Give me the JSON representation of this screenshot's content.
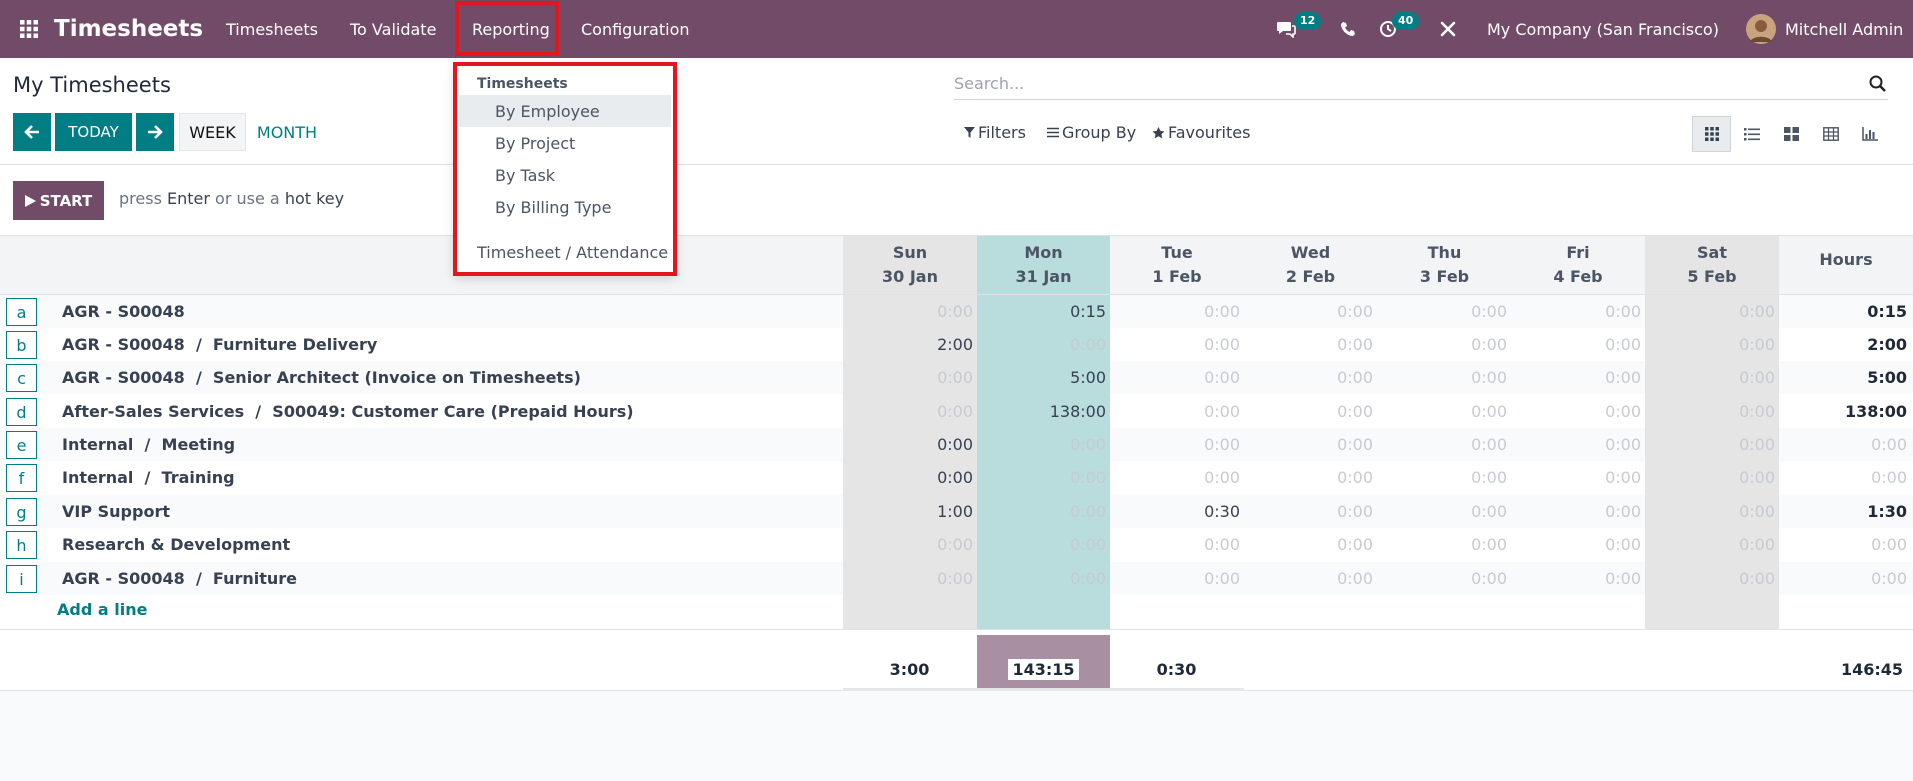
{
  "navbar": {
    "app_name": "Timesheets",
    "menus": [
      "Timesheets",
      "To Validate",
      "Reporting",
      "Configuration"
    ],
    "chat_badge": "12",
    "activity_badge": "40",
    "company": "My Company (San Francisco)",
    "user": "Mitchell Admin"
  },
  "control": {
    "title": "My Timesheets",
    "today": "TODAY",
    "week": "WEEK",
    "month": "MONTH",
    "search_placeholder": "Search...",
    "filters": "Filters",
    "group_by": "Group By",
    "favourites": "Favourites"
  },
  "start": {
    "label": "START",
    "hint_prefix": "press",
    "hint_key1": "Enter",
    "hint_mid": "or use a",
    "hint_key2": "hot key"
  },
  "reporting_menu": {
    "header": "Timesheets",
    "items": [
      "By Employee",
      "By Project",
      "By Task",
      "By Billing Type"
    ],
    "extra": "Timesheet / Attendance"
  },
  "grid": {
    "days": [
      {
        "day": "Sun",
        "date": "30 Jan"
      },
      {
        "day": "Mon",
        "date": "31 Jan"
      },
      {
        "day": "Tue",
        "date": "1 Feb"
      },
      {
        "day": "Wed",
        "date": "2 Feb"
      },
      {
        "day": "Thu",
        "date": "3 Feb"
      },
      {
        "day": "Fri",
        "date": "4 Feb"
      },
      {
        "day": "Sat",
        "date": "5 Feb"
      }
    ],
    "hours_header": "Hours",
    "rows": [
      {
        "key": "a",
        "label": "AGR - S00048",
        "values": [
          "0:00",
          "0:15",
          "0:00",
          "0:00",
          "0:00",
          "0:00",
          "0:00"
        ],
        "total": "0:15"
      },
      {
        "key": "b",
        "label": "AGR - S00048  /  Furniture Delivery",
        "values": [
          "2:00",
          "0:00",
          "0:00",
          "0:00",
          "0:00",
          "0:00",
          "0:00"
        ],
        "total": "2:00"
      },
      {
        "key": "c",
        "label": "AGR - S00048  /  Senior Architect (Invoice on Timesheets)",
        "values": [
          "0:00",
          "5:00",
          "0:00",
          "0:00",
          "0:00",
          "0:00",
          "0:00"
        ],
        "total": "5:00"
      },
      {
        "key": "d",
        "label": "After-Sales Services  /  S00049: Customer Care (Prepaid Hours)",
        "values": [
          "0:00",
          "138:00",
          "0:00",
          "0:00",
          "0:00",
          "0:00",
          "0:00"
        ],
        "total": "138:00"
      },
      {
        "key": "e",
        "label": "Internal  /  Meeting",
        "values": [
          "0:00",
          "0:00",
          "0:00",
          "0:00",
          "0:00",
          "0:00",
          "0:00"
        ],
        "total": "0:00"
      },
      {
        "key": "f",
        "label": "Internal  /  Training",
        "values": [
          "0:00",
          "0:00",
          "0:00",
          "0:00",
          "0:00",
          "0:00",
          "0:00"
        ],
        "total": "0:00"
      },
      {
        "key": "g",
        "label": "VIP Support",
        "values": [
          "1:00",
          "0:00",
          "0:30",
          "0:00",
          "0:00",
          "0:00",
          "0:00"
        ],
        "total": "1:30"
      },
      {
        "key": "h",
        "label": "Research & Development",
        "values": [
          "0:00",
          "0:00",
          "0:00",
          "0:00",
          "0:00",
          "0:00",
          "0:00"
        ],
        "total": "0:00"
      },
      {
        "key": "i",
        "label": "AGR - S00048  /  Furniture",
        "values": [
          "0:00",
          "0:00",
          "0:00",
          "0:00",
          "0:00",
          "0:00",
          "0:00"
        ],
        "total": "0:00"
      }
    ],
    "add_line": "Add a line",
    "day_totals": [
      "3:00",
      "143:15",
      "0:30"
    ],
    "grand_total": "146:45"
  }
}
